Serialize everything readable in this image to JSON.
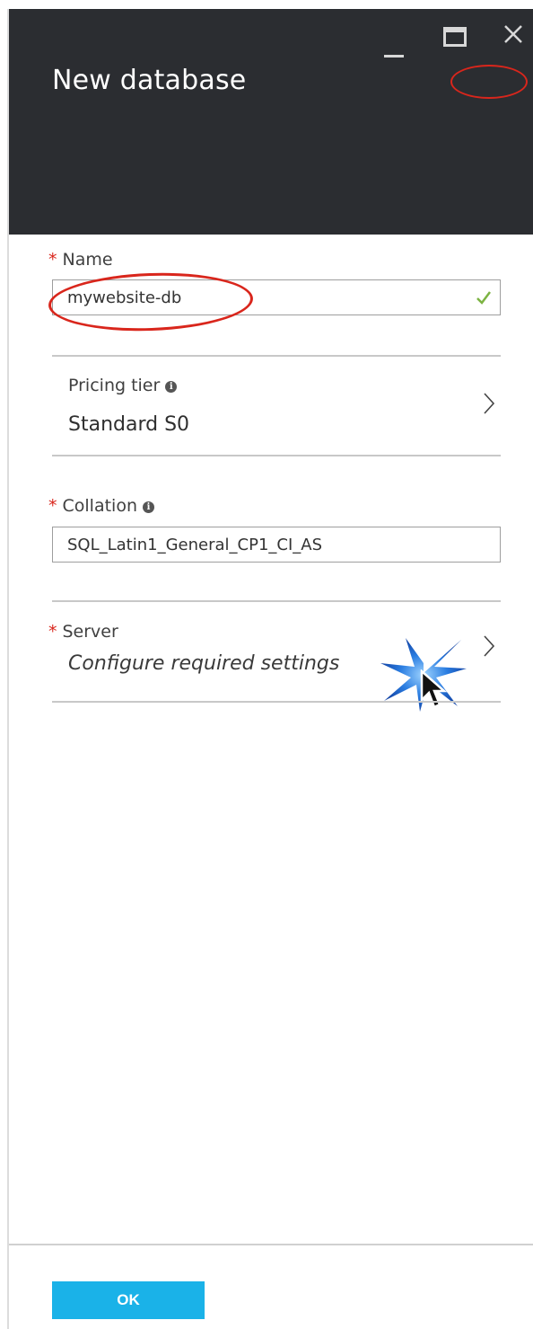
{
  "blade": {
    "title": "New database",
    "window_controls": {
      "minimize": "minimize-icon",
      "maximize": "maximize-icon",
      "close": "close-icon"
    }
  },
  "form": {
    "name": {
      "required_mark": "*",
      "label": "Name",
      "value": "mywebsite-db",
      "validation": "check-icon"
    },
    "pricing_tier": {
      "label": "Pricing tier",
      "info": "i",
      "value": "Standard S0"
    },
    "collation": {
      "required_mark": "*",
      "label": "Collation",
      "info": "i",
      "value": "SQL_Latin1_General_CP1_CI_AS"
    },
    "server": {
      "required_mark": "*",
      "label": "Server",
      "value": "Configure required settings"
    }
  },
  "footer": {
    "ok_label": "OK"
  },
  "colors": {
    "header_bg": "#2b2d31",
    "required": "#d9261c",
    "ok_button": "#1ab2e8",
    "valid_check": "#7cb342"
  }
}
